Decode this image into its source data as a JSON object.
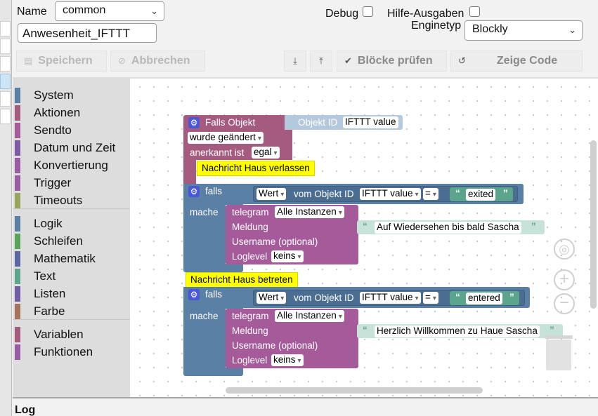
{
  "form": {
    "name_label": "Name",
    "folder_value": "common",
    "script_name_value": "Anwesenheit_IFTTT",
    "debug_label": "Debug",
    "hilfe_label": "Hilfe-Ausgaben",
    "enginetyp_label": "Enginetyp",
    "enginetyp_value": "Blockly"
  },
  "toolbar": {
    "save_label": "Speichern",
    "cancel_label": "Abbrechen",
    "check_label": "Blöcke prüfen",
    "show_code_label": "Zeige Code"
  },
  "toolbox": {
    "items": [
      {
        "label": "System",
        "color": "#5b80a5"
      },
      {
        "label": "Aktionen",
        "color": "#a55b80"
      },
      {
        "label": "Sendto",
        "color": "#a55b99"
      },
      {
        "label": "Datum und Zeit",
        "color": "#805ba5"
      },
      {
        "label": "Konvertierung",
        "color": "#9b5ba5"
      },
      {
        "label": "Trigger",
        "color": "#9b5ba5"
      },
      {
        "label": "Timeouts",
        "color": "#99a55b"
      },
      {
        "label": "Logik",
        "color": "#5b80a5"
      },
      {
        "label": "Schleifen",
        "color": "#5ba55b"
      },
      {
        "label": "Mathematik",
        "color": "#5b67a5"
      },
      {
        "label": "Text",
        "color": "#5ba58c"
      },
      {
        "label": "Listen",
        "color": "#745ba5"
      },
      {
        "label": "Farbe",
        "color": "#a5745b"
      },
      {
        "label": "Variablen",
        "color": "#a55b80"
      },
      {
        "label": "Funktionen",
        "color": "#995ba5"
      }
    ]
  },
  "workspace": {
    "trigger": {
      "title": "Falls Objekt",
      "object_id_label": "Objekt ID",
      "object_id_value": "IFTTT value",
      "changed_value": "wurde geändert",
      "ack_label": "anerkannt ist",
      "ack_value": "egal"
    },
    "comment_leave": "Nachricht Haus verlassen",
    "comment_enter": "Nachricht Haus betreten",
    "if1": {
      "falls": "falls",
      "mache": "mache",
      "wert": "Wert",
      "vom_objekt": "vom Objekt ID",
      "object_value": "IFTTT value",
      "op": "=",
      "text": "exited"
    },
    "tg1": {
      "telegram": "telegram",
      "instances": "Alle Instanzen",
      "meldung": "Meldung",
      "message": "Auf Wiedersehen bis bald Sascha",
      "username": "Username (optional)",
      "loglevel": "Loglevel",
      "loglevel_value": "keins"
    },
    "if2": {
      "falls": "falls",
      "mache": "mache",
      "wert": "Wert",
      "vom_objekt": "vom Objekt ID",
      "object_value": "IFTTT value",
      "op": "=",
      "text": "entered"
    },
    "tg2": {
      "telegram": "telegram",
      "instances": "Alle Instanzen",
      "meldung": "Meldung",
      "message": "Herzlich Willkommen zu Haue Sascha",
      "username": "Username (optional)",
      "loglevel": "Loglevel",
      "loglevel_value": "keins"
    }
  },
  "log": {
    "label": "Log"
  },
  "colors": {
    "trigger_block": "#a55b80",
    "logic_block": "#5b80a5",
    "telegram_block": "#a55b99",
    "text_block": "#5ba58c",
    "comment": "#ffff00"
  }
}
